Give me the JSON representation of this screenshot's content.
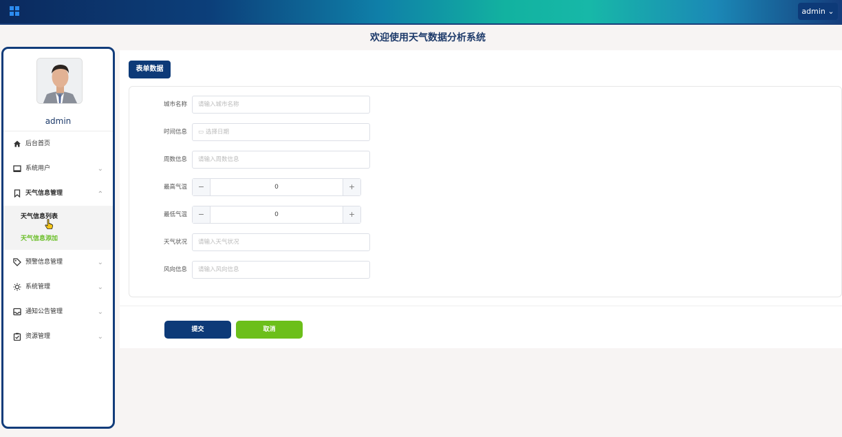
{
  "header": {
    "user_menu": "admin ⌄"
  },
  "page_title": "欢迎使用天气数据分析系统",
  "sidebar": {
    "username": "admin",
    "items": [
      {
        "label": "后台首页",
        "icon": "home-icon"
      },
      {
        "label": "系统用户",
        "icon": "monitor-icon"
      },
      {
        "label": "天气信息管理",
        "icon": "bookmark-icon",
        "expanded": true,
        "children": [
          {
            "label": "天气信息列表"
          },
          {
            "label": "天气信息添加"
          }
        ]
      },
      {
        "label": "预警信息管理",
        "icon": "tag-icon"
      },
      {
        "label": "系统管理",
        "icon": "sun-icon"
      },
      {
        "label": "通知公告管理",
        "icon": "inbox-icon"
      },
      {
        "label": "资源管理",
        "icon": "clipboard-icon"
      }
    ]
  },
  "form": {
    "title": "表单数据",
    "fields": [
      {
        "label": "城市名称",
        "placeholder": "请输入城市名称"
      },
      {
        "label": "时间信息",
        "placeholder": "选择日期"
      },
      {
        "label": "周数信息",
        "placeholder": "请输入周数信息"
      },
      {
        "label": "最高气温",
        "value": "0"
      },
      {
        "label": "最低气温",
        "value": "0"
      },
      {
        "label": "天气状况",
        "placeholder": "请输入天气状况"
      },
      {
        "label": "风向信息",
        "placeholder": "请输入风向信息"
      }
    ],
    "submit_label": "提交",
    "cancel_label": "取消"
  },
  "colors": {
    "primary": "#0d3a78",
    "accent_green": "#6cbf1a"
  }
}
